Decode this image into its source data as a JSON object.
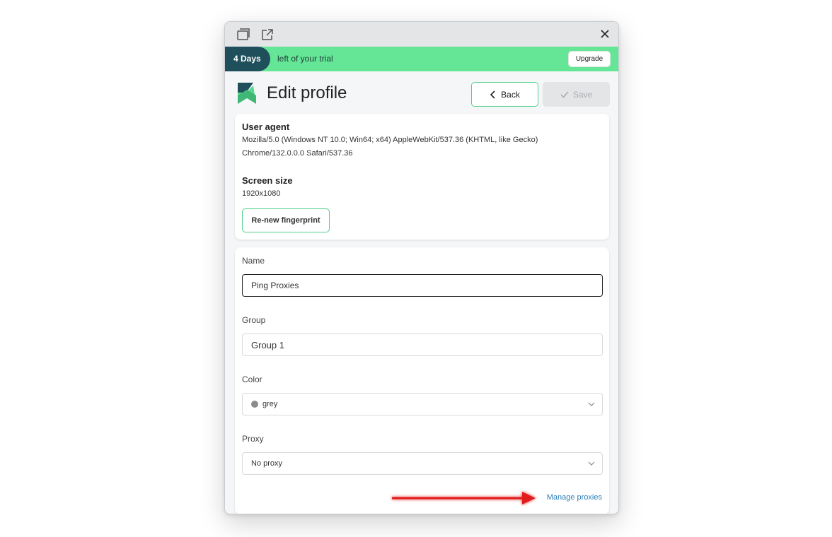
{
  "trial": {
    "days": "4 Days",
    "text": "left of your trial",
    "upgrade_label": "Upgrade"
  },
  "header": {
    "title": "Edit profile",
    "back_label": "Back",
    "save_label": "Save"
  },
  "fingerprint": {
    "user_agent_heading": "User agent",
    "user_agent_value": "Mozilla/5.0 (Windows NT 10.0; Win64; x64) AppleWebKit/537.36 (KHTML, like Gecko) Chrome/132.0.0.0 Safari/537.36",
    "screen_size_heading": "Screen size",
    "screen_size_value": "1920x1080",
    "renew_label": "Re-new fingerprint"
  },
  "form": {
    "name_label": "Name",
    "name_value": "Ping Proxies",
    "group_label": "Group",
    "group_value": "Group 1",
    "color_label": "Color",
    "color_value": "grey",
    "color_hex": "#8c8c8c",
    "proxy_label": "Proxy",
    "proxy_value": "No proxy",
    "manage_proxies_label": "Manage proxies"
  },
  "colors": {
    "accent": "#65e596",
    "dark_teal": "#1f4f5b",
    "annotation_arrow": "#e11b1b"
  }
}
